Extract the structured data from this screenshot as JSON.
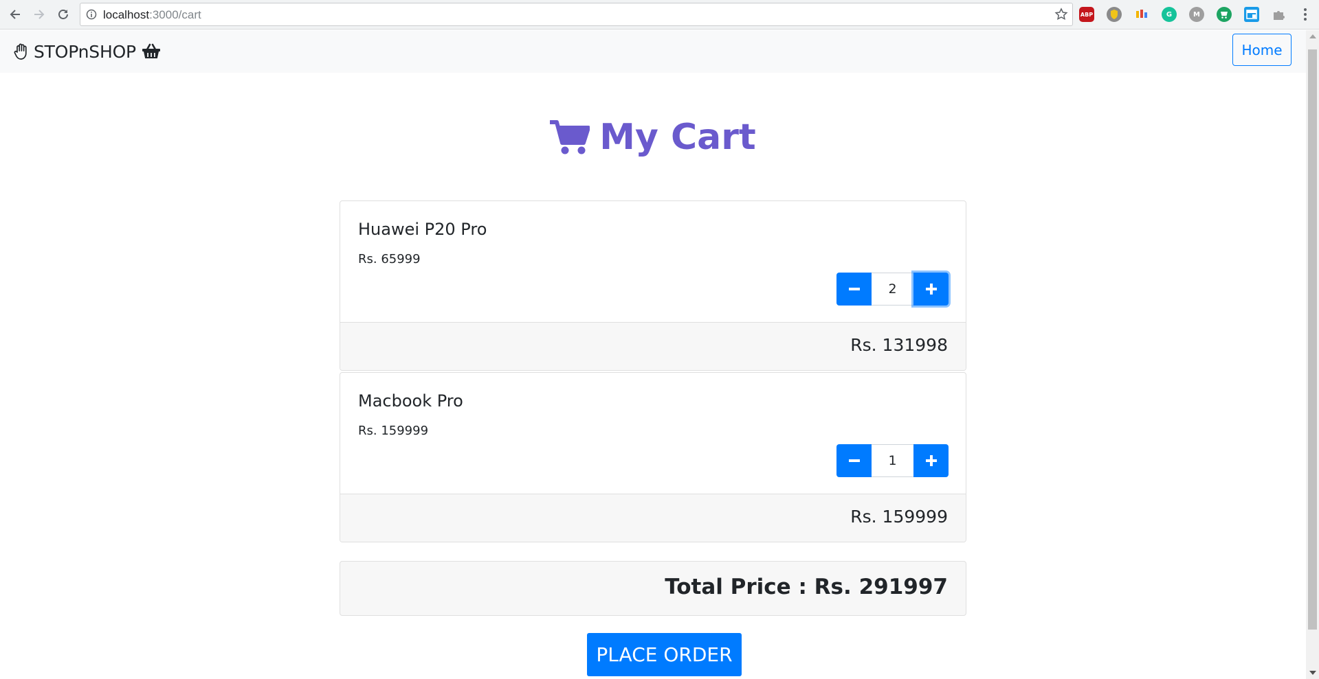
{
  "browser": {
    "url_host": "localhost",
    "url_path": ":3000/cart",
    "extensions": [
      {
        "name": "adblock-plus-icon",
        "label": "ABP",
        "color": "#c4161c"
      },
      {
        "name": "shield-extension-icon",
        "label": "",
        "color": "#8a8a8a"
      },
      {
        "name": "colorful-extension-icon",
        "label": "",
        "color": "#ffffff"
      },
      {
        "name": "grammarly-icon",
        "label": "G",
        "color": "#15c39a"
      },
      {
        "name": "m-extension-icon",
        "label": "M",
        "color": "#9e9e9e"
      },
      {
        "name": "shopping-extension-icon",
        "label": "",
        "color": "#1da462"
      },
      {
        "name": "window-extension-icon",
        "label": "",
        "color": "#1a9be8"
      },
      {
        "name": "puzzle-extension-icon",
        "label": "",
        "color": "#bdbdbd"
      }
    ]
  },
  "navbar": {
    "brand": "STOPnSHOP",
    "home_label": "Home"
  },
  "page": {
    "title": "My Cart",
    "accent_color": "#6a5acd",
    "primary_color": "#007bff"
  },
  "cart": {
    "items": [
      {
        "name": "Huawei P20 Pro",
        "price": "Rs. 65999",
        "quantity": "2",
        "subtotal": "Rs. 131998"
      },
      {
        "name": "Macbook Pro",
        "price": "Rs. 159999",
        "quantity": "1",
        "subtotal": "Rs. 159999"
      }
    ],
    "total": "Total Price : Rs. 291997",
    "place_order_label": "PLACE ORDER"
  }
}
